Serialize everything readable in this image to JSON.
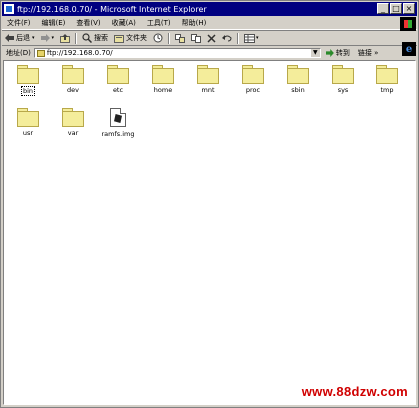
{
  "window": {
    "title": "ftp://192.168.0.70/ - Microsoft Internet Explorer",
    "buttons": [
      "_",
      "□",
      "×"
    ]
  },
  "menu": [
    "文件(F)",
    "编辑(E)",
    "查看(V)",
    "收藏(A)",
    "工具(T)",
    "帮助(H)"
  ],
  "toolbar": {
    "back": "后退",
    "search": "搜索",
    "folders": "文件夹"
  },
  "address": {
    "label": "地址(D)",
    "value": "ftp://192.168.0.70/",
    "go": "转到",
    "links": "链接"
  },
  "items": [
    {
      "name": "bin",
      "type": "folder",
      "selected": true
    },
    {
      "name": "dev",
      "type": "folder"
    },
    {
      "name": "etc",
      "type": "folder"
    },
    {
      "name": "home",
      "type": "folder"
    },
    {
      "name": "mnt",
      "type": "folder"
    },
    {
      "name": "proc",
      "type": "folder"
    },
    {
      "name": "sbin",
      "type": "folder"
    },
    {
      "name": "sys",
      "type": "folder"
    },
    {
      "name": "tmp",
      "type": "folder"
    },
    {
      "name": "usr",
      "type": "folder"
    },
    {
      "name": "var",
      "type": "folder"
    },
    {
      "name": "ramfs.img",
      "type": "file"
    }
  ],
  "watermark": "www.88dzw.com",
  "colors": {
    "titlebar": "#000080",
    "folder": "#f4ed9b",
    "watermark": "#d00000"
  }
}
